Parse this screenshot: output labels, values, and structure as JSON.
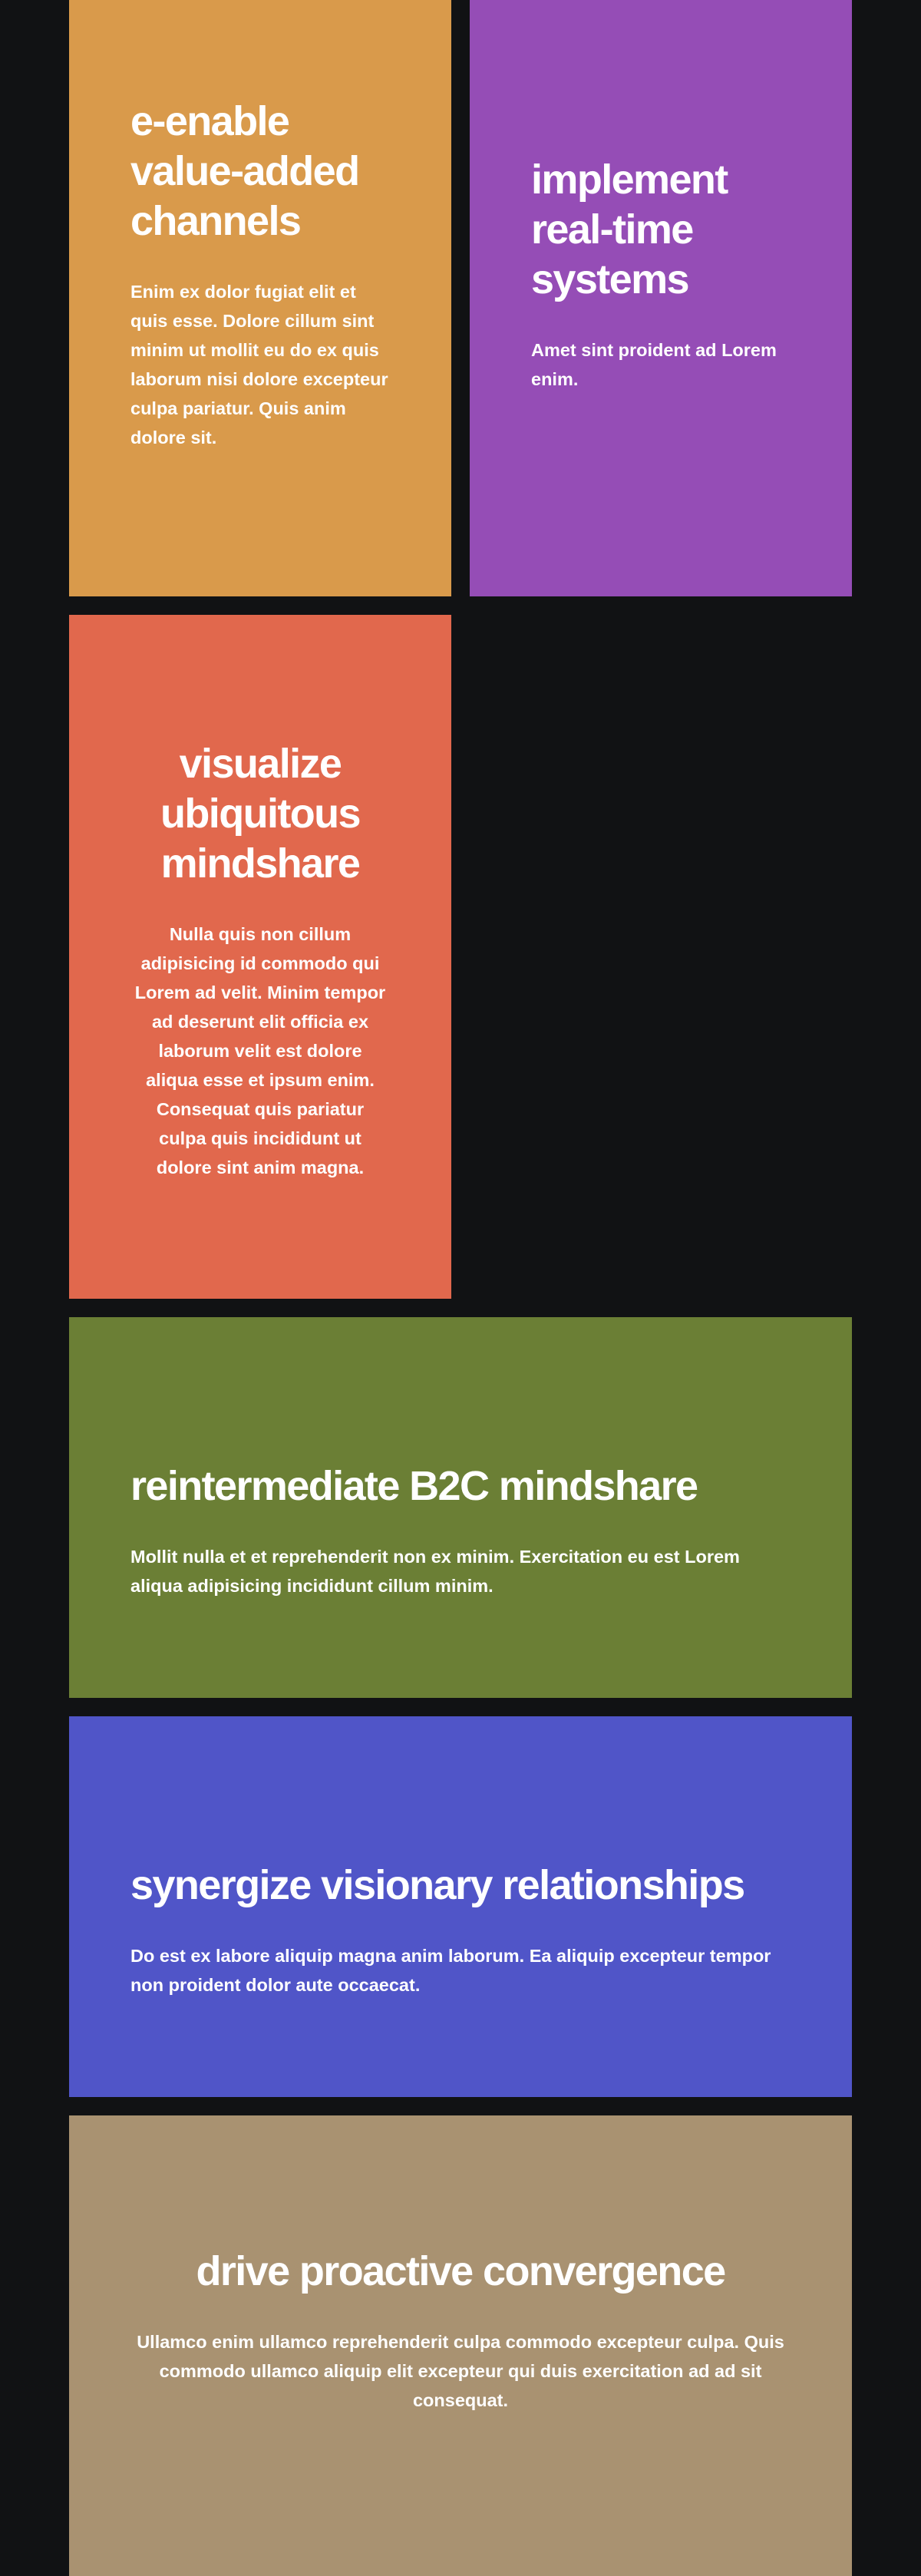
{
  "cards": [
    {
      "title_lines": [
        "e-enable",
        "value-added",
        "channels"
      ],
      "body": "Enim ex dolor fugiat elit et quis esse. Dolore cillum sint minim ut mollit eu do ex quis laborum nisi dolore excepteur culpa pariatur. Quis anim dolore sit.",
      "color": "#d99a4b",
      "align": "left"
    },
    {
      "title_lines": [
        "implement",
        "real-time",
        "systems"
      ],
      "body": "Amet sint proident ad Lorem enim.",
      "color": "#954db6",
      "align": "left"
    },
    {
      "title_lines": [
        "visualize",
        "ubiquitous",
        "mindshare"
      ],
      "body": "Nulla quis non cillum adipisicing id commodo qui Lorem ad velit. Minim tempor ad deserunt elit officia ex laborum velit est dolore aliqua esse et ipsum enim. Consequat quis pariatur culpa quis incididunt ut dolore sint anim magna.",
      "color": "#e1684d",
      "align": "center"
    },
    {
      "title": "reintermediate B2C mindshare",
      "body": "Mollit nulla et et reprehenderit non ex minim. Exercitation eu est Lorem aliqua adipisicing incididunt cillum minim.",
      "color": "#6b7f35",
      "align": "left"
    },
    {
      "title": "synergize visionary relationships",
      "body": "Do est ex labore aliquip magna anim laborum. Ea aliquip excepteur tempor non proident dolor aute occaecat.",
      "color": "#5055c8",
      "align": "left"
    },
    {
      "title": "drive proactive convergence",
      "body": "Ullamco enim ullamco reprehenderit culpa commodo excepteur culpa. Quis commodo ullamco aliquip elit excepteur qui duis exercitation ad ad sit consequat.",
      "color": "#a99271",
      "align": "center"
    }
  ]
}
